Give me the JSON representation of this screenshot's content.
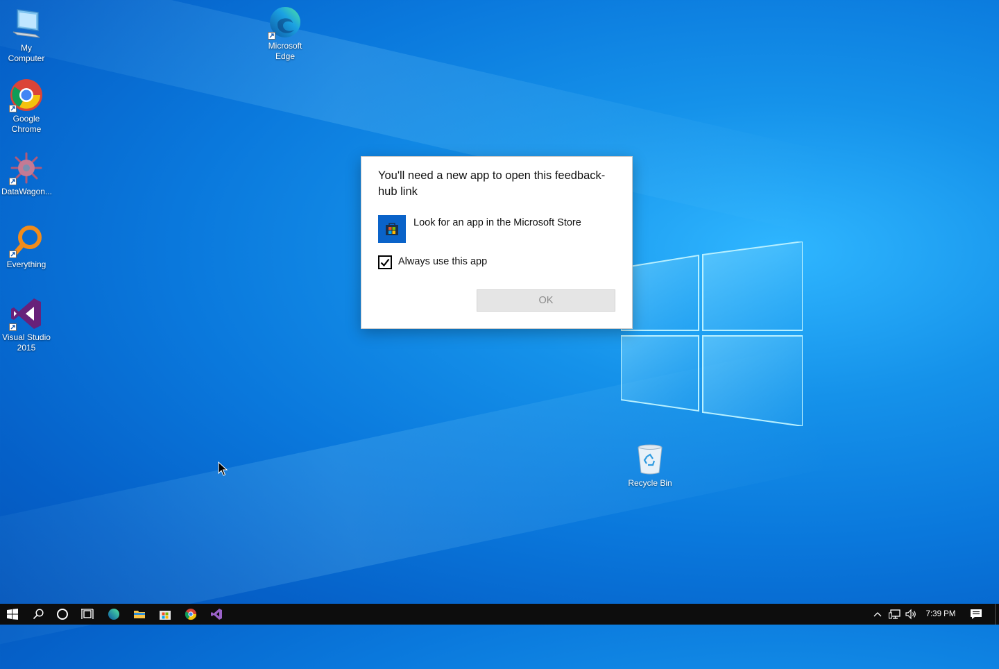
{
  "desktop": {
    "icons": [
      {
        "label": "My Computer",
        "icon": "computer-icon"
      },
      {
        "label": "Google Chrome",
        "icon": "chrome-icon"
      },
      {
        "label": "DataWagon...",
        "icon": "datawagon-icon"
      },
      {
        "label": "Everything",
        "icon": "everything-search-icon"
      },
      {
        "label": "Visual Studio 2015",
        "icon": "visual-studio-icon"
      },
      {
        "label": "Microsoft Edge",
        "icon": "edge-icon"
      },
      {
        "label": "Recycle Bin",
        "icon": "recycle-bin-icon"
      }
    ]
  },
  "dialog": {
    "title": "You'll need a new app to open this feedback-hub link",
    "option_label": "Look for an app in the Microsoft Store",
    "option_icon": "microsoft-store-icon",
    "checkbox_label": "Always use this app",
    "checkbox_checked": true,
    "ok_label": "OK"
  },
  "taskbar": {
    "buttons": [
      "start-icon",
      "search-icon",
      "cortana-icon",
      "task-view-icon",
      "edge-icon",
      "file-explorer-icon",
      "microsoft-store-icon",
      "chrome-icon",
      "visual-studio-icon"
    ],
    "tray": [
      "chevron-up-icon",
      "network-icon",
      "volume-icon"
    ],
    "clock": "7:39 PM",
    "notification_icon": "action-center-icon"
  },
  "colors": {
    "desktop_blue": "#0a78dc",
    "taskbar": "#0d0d0d",
    "store_tile": "#0a63c9",
    "ok_button_bg": "#e5e5e5"
  }
}
